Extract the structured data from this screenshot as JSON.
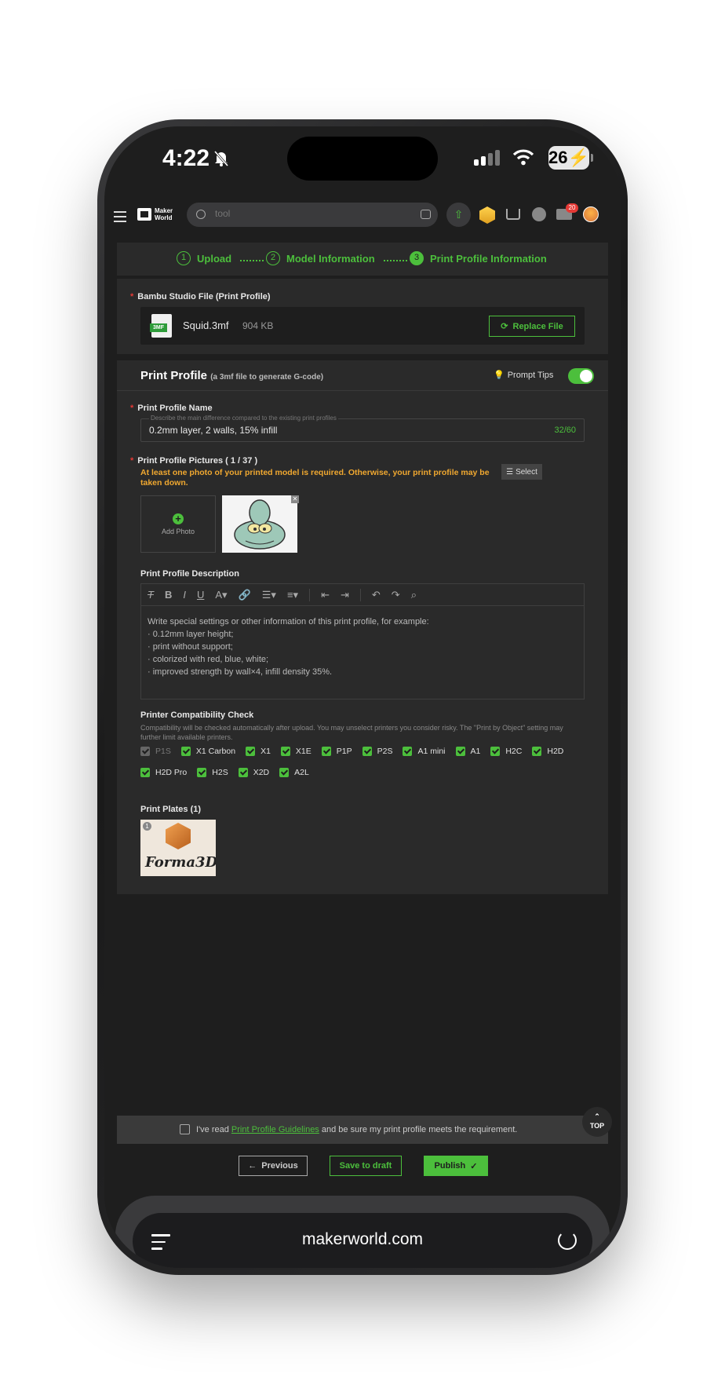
{
  "status_bar": {
    "time": "4:22",
    "battery": "26"
  },
  "header": {
    "logo_line1": "Maker",
    "logo_line2": "World",
    "search_placeholder": "tool",
    "mail_badge": "20"
  },
  "steps": [
    {
      "num": "1",
      "label": "Upload"
    },
    {
      "num": "2",
      "label": "Model Information"
    },
    {
      "num": "3",
      "label": "Print Profile Information"
    }
  ],
  "file_section": {
    "label": "Bambu Studio File (Print Profile)",
    "file_type": "3MF",
    "file_name": "Squid.3mf",
    "file_size": "904 KB",
    "replace_label": "Replace File"
  },
  "print_profile": {
    "title": "Print Profile",
    "subtitle": "(a 3mf file to generate G-code)",
    "tips_label": "Prompt Tips",
    "name_label": "Print Profile Name",
    "name_hint": "Describe the main difference compared to the existing print profiles",
    "name_value": "0.2mm layer, 2 walls, 15% infill",
    "name_count": "32/60",
    "pictures_label": "Print Profile Pictures ( 1 / 37 )",
    "pictures_warning": "At least one photo of your printed model is required. Otherwise, your print profile may be taken down.",
    "select_label": "Select",
    "add_photo_label": "Add Photo",
    "description_label": "Print Profile Description",
    "description_lines": [
      "Write special settings or other information of this print profile, for example:",
      "· 0.12mm layer height;",
      "· print without support;",
      "· colorized with red, blue, white;",
      "· improved strength by wall×4, infill density 35%."
    ],
    "compat_label": "Printer Compatibility Check",
    "compat_note": "Compatibility will be checked automatically after upload. You may unselect printers you consider risky. The \"Print by Object\" setting may further limit available printers.",
    "printers": [
      {
        "name": "P1S",
        "checked": true,
        "disabled": true
      },
      {
        "name": "X1 Carbon",
        "checked": true,
        "disabled": false
      },
      {
        "name": "X1",
        "checked": true,
        "disabled": false
      },
      {
        "name": "X1E",
        "checked": true,
        "disabled": false
      },
      {
        "name": "P1P",
        "checked": true,
        "disabled": false
      },
      {
        "name": "P2S",
        "checked": true,
        "disabled": false
      },
      {
        "name": "A1 mini",
        "checked": true,
        "disabled": false
      },
      {
        "name": "A1",
        "checked": true,
        "disabled": false
      },
      {
        "name": "H2C",
        "checked": true,
        "disabled": false
      },
      {
        "name": "H2D",
        "checked": true,
        "disabled": false
      },
      {
        "name": "H2D Pro",
        "checked": true,
        "disabled": false
      },
      {
        "name": "H2S",
        "checked": true,
        "disabled": false
      },
      {
        "name": "X2D",
        "checked": true,
        "disabled": false
      },
      {
        "name": "A2L",
        "checked": true,
        "disabled": false
      }
    ],
    "plates_label": "Print Plates (1)",
    "plate_num": "1",
    "plate_brand": "Forma3D"
  },
  "footer": {
    "agree_prefix": "I've read",
    "agree_link": "Print Profile Guidelines",
    "agree_suffix": "and be sure my print profile meets the requirement.",
    "top_label": "TOP",
    "prev_label": "Previous",
    "draft_label": "Save to draft",
    "publish_label": "Publish"
  },
  "browser": {
    "url": "makerworld.com"
  },
  "colors": {
    "accent": "#4cbf3c",
    "warning": "#f0a830",
    "background": "#1e1e1e",
    "card": "#2a2a2a"
  }
}
